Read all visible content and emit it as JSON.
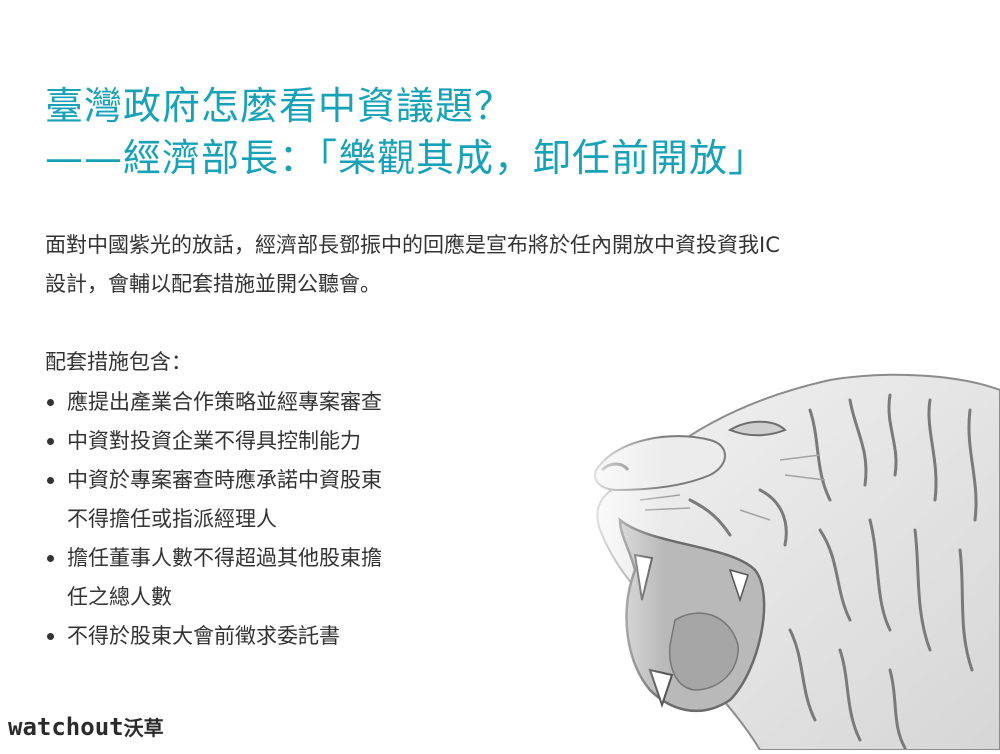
{
  "title": {
    "line1": "臺灣政府怎麼看中資議題？",
    "line2": "——經濟部長：「樂觀其成，卸任前開放」"
  },
  "intro": {
    "line1": "面對中國紫光的放話，經濟部長鄧振中的回應是宣布將於任內開放中資投資我IC",
    "line2": "設計，會輔以配套措施並開公聽會。"
  },
  "measures": {
    "heading": "配套措施包含：",
    "items": [
      {
        "lines": [
          "應提出產業合作策略並經專案審查"
        ]
      },
      {
        "lines": [
          "中資對投資企業不得具控制能力"
        ]
      },
      {
        "lines": [
          "中資於專案審查時應承諾中資股東",
          "不得擔任或指派經理人"
        ]
      },
      {
        "lines": [
          "擔任董事人數不得超過其他股東擔",
          "任之總人數"
        ]
      },
      {
        "lines": [
          "不得於股東大會前徵求委託書"
        ]
      }
    ]
  },
  "logo": {
    "latin": "watchout",
    "cjk": "沃草"
  },
  "colors": {
    "title": "#17a2b8",
    "body_text": "#333333",
    "illustration": "#9a9a9a"
  },
  "illustration": {
    "icon": "roaring-tiger-sketch"
  }
}
